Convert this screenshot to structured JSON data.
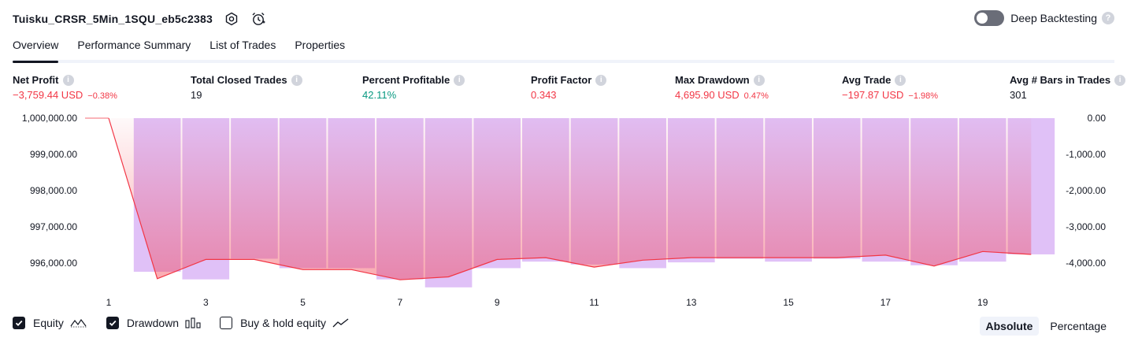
{
  "header": {
    "strategy_name": "Tuisku_CRSR_5Min_1SQU_eb5c2383",
    "deep_backtesting_label": "Deep Backtesting",
    "help_glyph": "?"
  },
  "tabs": [
    {
      "label": "Overview",
      "active": true
    },
    {
      "label": "Performance Summary",
      "active": false
    },
    {
      "label": "List of Trades",
      "active": false
    },
    {
      "label": "Properties",
      "active": false
    }
  ],
  "stats": {
    "net_profit": {
      "label": "Net Profit",
      "value": "−3,759.44 USD",
      "pct": "−0.38%"
    },
    "total_closed_trades": {
      "label": "Total Closed Trades",
      "value": "19"
    },
    "percent_profitable": {
      "label": "Percent Profitable",
      "value": "42.11%"
    },
    "profit_factor": {
      "label": "Profit Factor",
      "value": "0.343"
    },
    "max_drawdown": {
      "label": "Max Drawdown",
      "value": "4,695.90 USD",
      "pct": "0.47%"
    },
    "avg_trade": {
      "label": "Avg Trade",
      "value": "−197.87 USD",
      "pct": "−1.98%"
    },
    "avg_bars": {
      "label": "Avg # Bars in Trades",
      "value": "301"
    }
  },
  "chart_data": {
    "type": "area",
    "left_axis": {
      "label": "Equity",
      "ylim": [
        995500,
        1000000
      ],
      "ticks": [
        "1,000,000.00",
        "999,000.00",
        "998,000.00",
        "997,000.00",
        "996,000.00"
      ]
    },
    "right_axis": {
      "label": "Drawdown",
      "ylim": [
        -4750,
        0
      ],
      "ticks": [
        "0.00",
        "-1,000.00",
        "-2,000.00",
        "-3,000.00",
        "-4,000.00"
      ]
    },
    "x_ticks": [
      "1",
      "3",
      "5",
      "7",
      "9",
      "11",
      "13",
      "15",
      "17",
      "19"
    ],
    "equity": {
      "name": "Equity",
      "x": [
        1,
        2,
        3,
        4,
        5,
        6,
        7,
        8,
        9,
        10,
        11,
        12,
        13,
        14,
        15,
        16,
        17,
        18,
        19,
        20
      ],
      "values": [
        1000000,
        995570,
        996100,
        996100,
        995820,
        995820,
        995540,
        995620,
        996100,
        996150,
        995890,
        996080,
        996150,
        996150,
        996150,
        996150,
        996220,
        995920,
        996320,
        996240
      ]
    },
    "drawdown": {
      "name": "Drawdown",
      "x": [
        2,
        3,
        4,
        5,
        6,
        7,
        8,
        9,
        10,
        11,
        12,
        13,
        14,
        15,
        16,
        17,
        18,
        19,
        20
      ],
      "values": [
        -4240,
        -4450,
        -3880,
        -4140,
        -4140,
        -4450,
        -4670,
        -4140,
        -3960,
        -4040,
        -4140,
        -3980,
        -3880,
        -3960,
        -3880,
        -3960,
        -4060,
        -3960,
        -3760
      ]
    },
    "legend": [
      {
        "label": "Equity",
        "checked": true,
        "icon": "equity-line-icon"
      },
      {
        "label": "Drawdown",
        "checked": true,
        "icon": "drawdown-bars-icon"
      },
      {
        "label": "Buy & hold equity",
        "checked": false,
        "icon": "buy-hold-line-icon"
      }
    ],
    "colors": {
      "equity_line": "#f23645",
      "drawdown_bar": "#e0c1f7",
      "equity_fill": "#f4a6b8",
      "neg": "#f23645",
      "pos": "#089981"
    }
  },
  "scale_buttons": {
    "absolute": "Absolute",
    "percentage": "Percentage",
    "active": "absolute"
  }
}
